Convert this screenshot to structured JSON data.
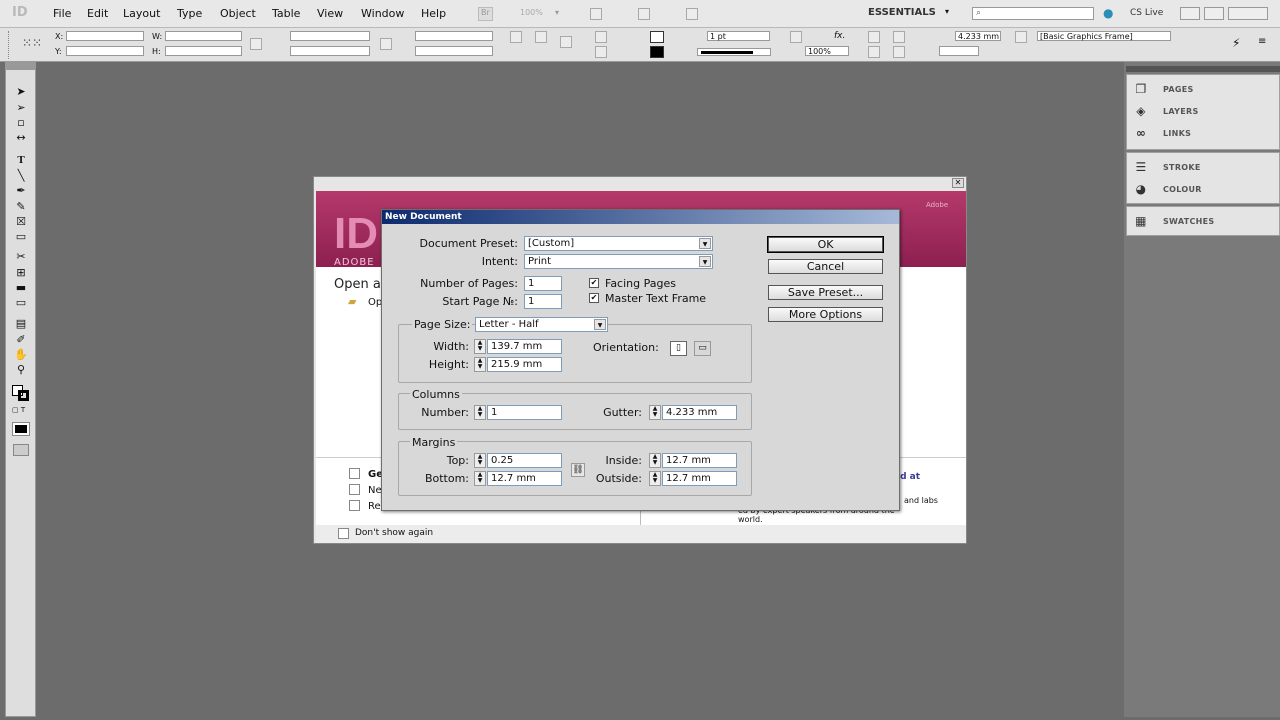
{
  "app": {
    "logo": "ID",
    "menu": [
      "File",
      "Edit",
      "Layout",
      "Type",
      "Object",
      "Table",
      "View",
      "Window",
      "Help"
    ],
    "bridge_label": "Br",
    "zoom": "100%",
    "workspace": "ESSENTIALS",
    "cs_live": "CS Live"
  },
  "control_panel": {
    "x_label": "X:",
    "y_label": "Y:",
    "w_label": "W:",
    "h_label": "H:",
    "stroke_weight": "1 pt",
    "opacity": "100%",
    "gutter_value": "4.233 mm",
    "frame_style": "[Basic Graphics Frame]"
  },
  "panels": [
    {
      "label": "PAGES",
      "icon": "pages-icon"
    },
    {
      "label": "LAYERS",
      "icon": "layers-icon"
    },
    {
      "label": "LINKS",
      "icon": "links-icon"
    },
    {
      "label": "STROKE",
      "icon": "stroke-icon"
    },
    {
      "label": "COLOUR",
      "icon": "colour-icon"
    },
    {
      "label": "SWATCHES",
      "icon": "swatches-icon"
    }
  ],
  "welcome": {
    "logo": "ID",
    "adobe_text": "ADOBE",
    "open_heading": "Open a",
    "open_item": "Op",
    "list_items": [
      "Ge",
      "Ne",
      "Re"
    ],
    "right_link": "ed at",
    "right_text_1": "and labs",
    "right_text_2": "ed by expert speakers from around the",
    "right_text_3": "world.",
    "dont_show": "Don't show again",
    "adobe_corner": "Adobe"
  },
  "dialog": {
    "title": "New Document",
    "document_preset_label": "Document Preset:",
    "document_preset_value": "[Custom]",
    "intent_label": "Intent:",
    "intent_value": "Print",
    "num_pages_label": "Number of Pages:",
    "num_pages_value": "1",
    "start_page_label": "Start Page №:",
    "start_page_value": "1",
    "facing_pages_label": "Facing Pages",
    "facing_pages_checked": true,
    "master_text_frame_label": "Master Text Frame",
    "master_text_frame_checked": true,
    "page_size_label": "Page Size:",
    "page_size_value": "Letter - Half",
    "width_label": "Width:",
    "width_value": "139.7 mm",
    "height_label": "Height:",
    "height_value": "215.9 mm",
    "orientation_label": "Orientation:",
    "columns_heading": "Columns",
    "number_label": "Number:",
    "number_value": "1",
    "gutter_label": "Gutter:",
    "gutter_value": "4.233 mm",
    "margins_heading": "Margins",
    "top_label": "Top:",
    "top_value": "0.25",
    "bottom_label": "Bottom:",
    "bottom_value": "12.7 mm",
    "inside_label": "Inside:",
    "inside_value": "12.7 mm",
    "outside_label": "Outside:",
    "outside_value": "12.7 mm",
    "ok_label": "OK",
    "cancel_label": "Cancel",
    "save_preset_label": "Save Preset...",
    "more_options_label": "More Options"
  }
}
